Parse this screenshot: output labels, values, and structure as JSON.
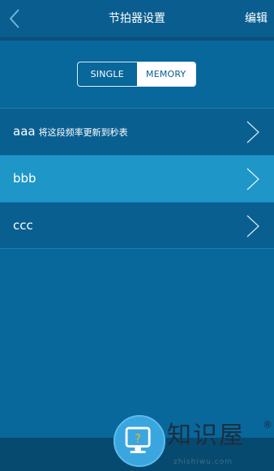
{
  "header": {
    "title": "节拍器设置",
    "edit_label": "编辑"
  },
  "mode_toggle": {
    "options": [
      "SINGLE",
      "MEMORY"
    ],
    "selected": "MEMORY"
  },
  "list": {
    "items": [
      {
        "name": "aaa",
        "note": "将这段频率更新到秒表",
        "selected": false
      },
      {
        "name": "bbb",
        "note": "",
        "selected": true
      },
      {
        "name": "ccc",
        "note": "",
        "selected": false
      }
    ]
  },
  "watermark": {
    "text": "知识屋",
    "registered": "®",
    "subtext": "zhishiwu.com",
    "badge_icon": "question-monitor-icon"
  },
  "icons": {
    "back": "chevron-left-icon",
    "row_arrow": "chevron-right-icon"
  },
  "colors": {
    "background": "#08679b",
    "header": "#0a5e8f",
    "row": "#0a5f91",
    "row_selected": "#1e96c8",
    "bottom_bar": "#074a70"
  }
}
